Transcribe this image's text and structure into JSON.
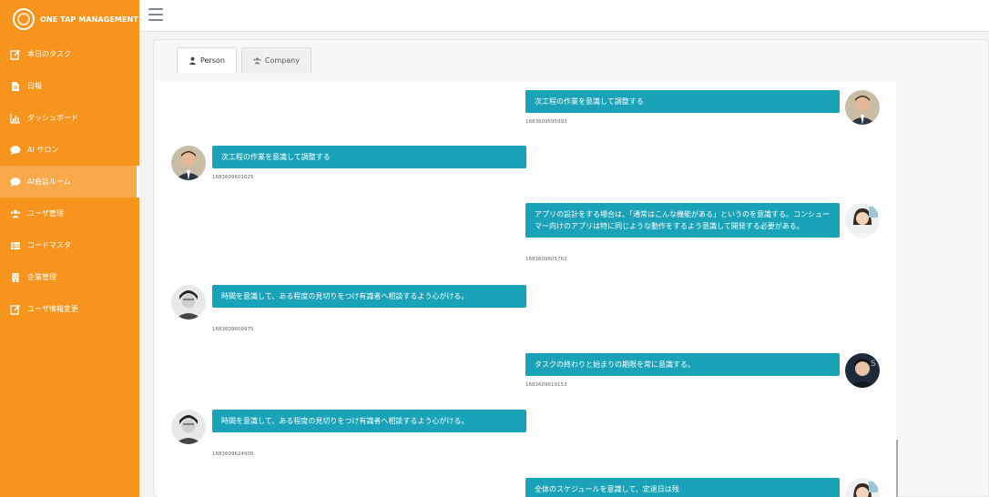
{
  "brand": {
    "name": "ONE TAP MANAGEMENT"
  },
  "sidebar": {
    "items": [
      {
        "label": "本日のタスク",
        "icon": "edit-icon"
      },
      {
        "label": "日報",
        "icon": "file-icon"
      },
      {
        "label": "ダッシュボード",
        "icon": "bar-chart-icon"
      },
      {
        "label": "AI サロン",
        "icon": "chat-bubble-icon"
      },
      {
        "label": "AI会話ルーム",
        "icon": "chat-bubble-icon",
        "active": true
      },
      {
        "label": "ユーザ管理",
        "icon": "users-icon"
      },
      {
        "label": "コードマスタ",
        "icon": "table-icon"
      },
      {
        "label": "企業管理",
        "icon": "building-icon"
      },
      {
        "label": "ユーザ情報変更",
        "icon": "edit-icon"
      }
    ]
  },
  "tabs": [
    {
      "label": "Person",
      "icon": "user-icon",
      "active": true
    },
    {
      "label": "Company",
      "icon": "users-icon",
      "active": false
    }
  ],
  "messages": [
    {
      "side": "right",
      "text": "次工程の作業を意識して調整する",
      "timestamp": "1683609595993",
      "avatar": "man-suit"
    },
    {
      "side": "left",
      "text": "次工程の作業を意識して調整する",
      "timestamp": "1683609601625",
      "avatar": "man-suit"
    },
    {
      "side": "right",
      "text": "アプリの設計をする場合は、「通常はこんな機能がある」というのを意識する。コンシューマー向けのアプリは特に同じような動作をするよう意識して開発する必要がある。",
      "timestamp": "1683609605762",
      "avatar": "woman"
    },
    {
      "side": "left",
      "text": "時間を意識して、ある程度の見切りをつけ有識者へ相談するよう心がける。",
      "timestamp": "1683609609975",
      "avatar": "man-bw"
    },
    {
      "side": "right",
      "text": "タスクの終わりと始まりの期限を常に意識する。",
      "timestamp": "1683609619153",
      "avatar": "man-dark"
    },
    {
      "side": "left",
      "text": "時間を意識して、ある程度の見切りをつけ有識者へ相談するよう心がける。",
      "timestamp": "1683609624905",
      "avatar": "man-bw"
    },
    {
      "side": "right",
      "text": "全体のスケジュールを意識して、定退日は残",
      "timestamp": "",
      "avatar": "woman"
    }
  ],
  "colors": {
    "sidebar": "#f7941d",
    "bubble": "#1aa3b8"
  }
}
